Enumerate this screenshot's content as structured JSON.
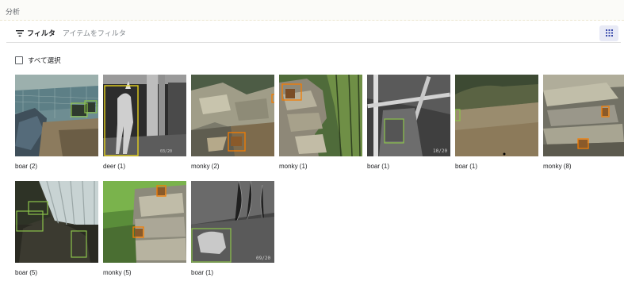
{
  "header": {
    "title": "分析"
  },
  "filter": {
    "label": "フィルタ",
    "placeholder": "アイテムをフィルタ"
  },
  "select_all": {
    "label": "すべて選択"
  },
  "items": [
    {
      "caption": "boar (2)",
      "scene": "fence"
    },
    {
      "caption": "deer (1)",
      "scene": "deer-night"
    },
    {
      "caption": "monky (2)",
      "scene": "rocks-a"
    },
    {
      "caption": "monky (1)",
      "scene": "rocks-forest"
    },
    {
      "caption": "boar (1)",
      "scene": "night-frame",
      "stamp": "10/20"
    },
    {
      "caption": "boar (1)",
      "scene": "ground"
    },
    {
      "caption": "monky (8)",
      "scene": "rocks-b"
    },
    {
      "caption": "boar (5)",
      "scene": "tree-night"
    },
    {
      "caption": "monky (5)",
      "scene": "rocks-green"
    },
    {
      "caption": "boar (1)",
      "scene": "boar-night",
      "stamp": "09/20"
    }
  ],
  "colors": {
    "box_green": "#8bc34a",
    "box_orange": "#f57c00",
    "box_yellow": "#e6d21e",
    "accent": "#3949ab"
  },
  "icons": [
    "filter-icon",
    "grid-view-icon"
  ]
}
